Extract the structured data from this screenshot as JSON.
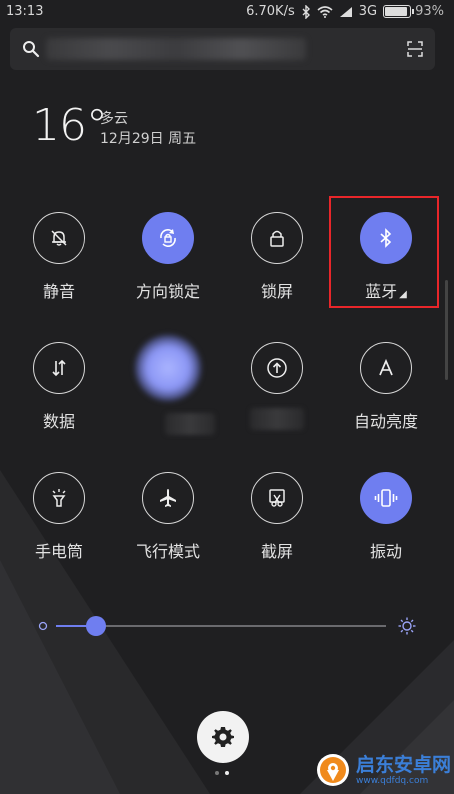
{
  "status_bar": {
    "time": "13:13",
    "net_speed": "6.70K/s",
    "network": "3G",
    "battery": "93%"
  },
  "search": {
    "search_icon": "search-icon",
    "scan_icon": "scan-icon"
  },
  "weather": {
    "temperature": "16°",
    "condition": "多云",
    "date": "12月29日 周五"
  },
  "tiles": [
    {
      "label": "静音",
      "icon": "bell-off-icon",
      "active": false
    },
    {
      "label": "方向锁定",
      "icon": "rotation-lock-icon",
      "active": true
    },
    {
      "label": "锁屏",
      "icon": "lock-icon",
      "active": false
    },
    {
      "label": "蓝牙",
      "icon": "bluetooth-icon",
      "active": true,
      "has_menu": true
    },
    {
      "label": "数据",
      "icon": "data-arrows-icon",
      "active": false
    },
    {
      "label": "",
      "icon": "blurred-icon",
      "active": true
    },
    {
      "label": "",
      "icon": "upload-circle-icon",
      "active": false
    },
    {
      "label": "自动亮度",
      "icon": "auto-brightness-icon",
      "active": false
    },
    {
      "label": "手电筒",
      "icon": "flashlight-icon",
      "active": false
    },
    {
      "label": "飞行模式",
      "icon": "airplane-icon",
      "active": false
    },
    {
      "label": "截屏",
      "icon": "screenshot-icon",
      "active": false
    },
    {
      "label": "振动",
      "icon": "vibrate-icon",
      "active": true
    }
  ],
  "brightness": {
    "level_fraction": 0.12
  },
  "settings": {
    "icon": "gear-icon"
  },
  "pages": {
    "count": 2,
    "current": 2
  },
  "watermark": {
    "title": "启东安卓网",
    "url": "www.qdfdq.com"
  },
  "colors": {
    "accent": "#6f7ef0",
    "background": "#1f1f21",
    "highlight": "#e8262a"
  }
}
